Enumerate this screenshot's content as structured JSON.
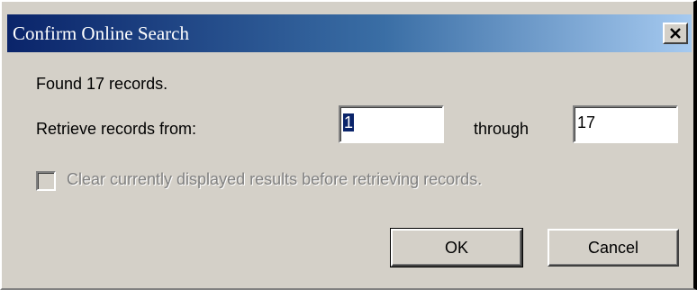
{
  "window": {
    "title": "Confirm Online Search",
    "close_icon": "close-icon"
  },
  "message": "Found 17 records.",
  "range": {
    "label": "Retrieve records from:",
    "from_value": "1",
    "through_label": "through",
    "to_value": "17"
  },
  "options": {
    "clear_label": "Clear currently displayed results before retrieving records.",
    "clear_checked": false,
    "clear_enabled": false
  },
  "buttons": {
    "ok_label": "OK",
    "cancel_label": "Cancel"
  },
  "colors": {
    "title_gradient_start": "#0a246a",
    "title_gradient_end": "#a6caf0",
    "dialog_face": "#d4d0c8",
    "disabled_text": "#808080"
  }
}
